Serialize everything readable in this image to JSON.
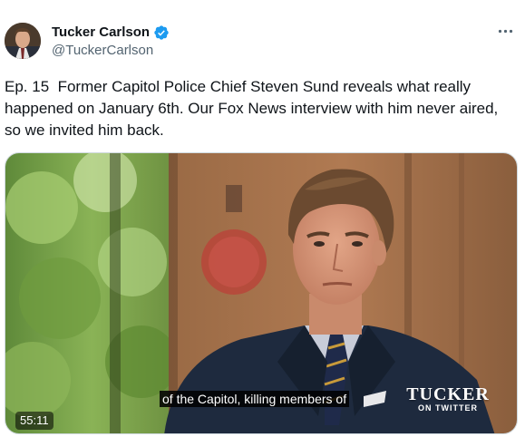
{
  "author": {
    "display_name": "Tucker Carlson",
    "handle": "@TuckerCarlson",
    "verified": true,
    "verified_color": "#1d9bf0"
  },
  "tweet": {
    "text": "Ep. 15  Former Capitol Police Chief Steven Sund reveals what really happened on January 6th. Our Fox News interview with him never aired, so we invited him back."
  },
  "video": {
    "caption": "of the Capitol, killing members of",
    "logo_main": "TUCKER",
    "logo_sub": "ON TWITTER",
    "duration": "55:11"
  },
  "icons": {
    "more": "more-options-icon",
    "verified": "verified-badge-icon"
  }
}
